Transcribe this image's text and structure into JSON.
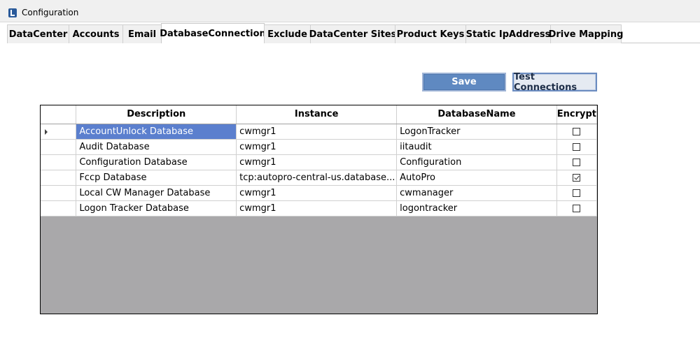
{
  "window": {
    "title": "Configuration"
  },
  "tabs": [
    {
      "label": "DataCenter"
    },
    {
      "label": "Accounts"
    },
    {
      "label": "Email"
    },
    {
      "label": "DatabaseConnection",
      "active": true
    },
    {
      "label": "Exclude"
    },
    {
      "label": "DataCenter Sites"
    },
    {
      "label": "Product Keys"
    },
    {
      "label": "Static IpAddress"
    },
    {
      "label": "Drive Mapping"
    }
  ],
  "toolbar": {
    "save_label": "Save",
    "test_label": "Test Connections"
  },
  "grid": {
    "columns": [
      "Description",
      "Instance",
      "DatabaseName",
      "Encrypt"
    ],
    "rows": [
      {
        "description": "AccountUnlock Database",
        "instance": "cwmgr1",
        "database": "LogonTracker",
        "encrypt": false,
        "selected": true
      },
      {
        "description": "Audit Database",
        "instance": "cwmgr1",
        "database": "iitaudit",
        "encrypt": false
      },
      {
        "description": "Configuration Database",
        "instance": "cwmgr1",
        "database": "Configuration",
        "encrypt": false
      },
      {
        "description": "Fccp Database",
        "instance": "tcp:autopro-central-us.database...",
        "database": "AutoPro",
        "encrypt": true
      },
      {
        "description": "Local CW Manager Database",
        "instance": "cwmgr1",
        "database": "cwmanager",
        "encrypt": false
      },
      {
        "description": "Logon Tracker Database",
        "instance": "cwmgr1",
        "database": "logontracker",
        "encrypt": false
      }
    ]
  },
  "colors": {
    "selection": "#5b7fce",
    "save_button": "#5f89c1",
    "grid_empty_area": "#a9a8aa"
  }
}
